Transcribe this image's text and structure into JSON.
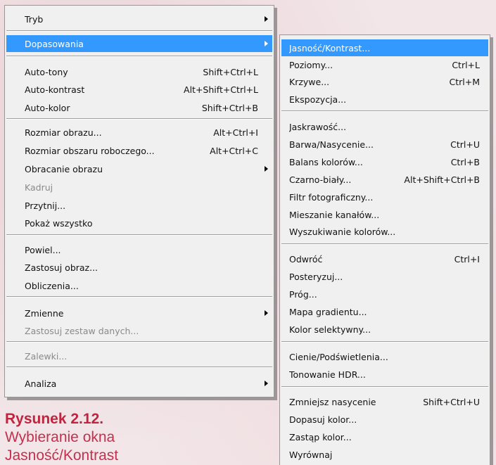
{
  "menu_main": {
    "tryb": {
      "label": "Tryb"
    },
    "dopasowania": {
      "label": "Dopasowania"
    },
    "auto_tony": {
      "label": "Auto-tony",
      "shortcut": "Shift+Ctrl+L"
    },
    "auto_kontrast": {
      "label": "Auto-kontrast",
      "shortcut": "Alt+Shift+Ctrl+L"
    },
    "auto_kolor": {
      "label": "Auto-kolor",
      "shortcut": "Shift+Ctrl+B"
    },
    "rozmiar_obrazu": {
      "label": "Rozmiar obrazu...",
      "shortcut": "Alt+Ctrl+I"
    },
    "rozmiar_obszaru": {
      "label": "Rozmiar obszaru roboczego...",
      "shortcut": "Alt+Ctrl+C"
    },
    "obracanie": {
      "label": "Obracanie obrazu"
    },
    "kadruj": {
      "label": "Kadruj"
    },
    "przytnij": {
      "label": "Przytnij..."
    },
    "pokaz_wszystko": {
      "label": "Pokaż wszystko"
    },
    "powiel": {
      "label": "Powiel..."
    },
    "zastosuj_obraz": {
      "label": "Zastosuj obraz..."
    },
    "obliczenia": {
      "label": "Obliczenia..."
    },
    "zmienne": {
      "label": "Zmienne"
    },
    "zastosuj_zestaw": {
      "label": "Zastosuj zestaw danych..."
    },
    "zalewki": {
      "label": "Zalewki..."
    },
    "analiza": {
      "label": "Analiza"
    }
  },
  "menu_adjust": {
    "jasnosc": {
      "label": "Jasność/Kontrast..."
    },
    "poziomy": {
      "label": "Poziomy...",
      "shortcut": "Ctrl+L"
    },
    "krzywe": {
      "label": "Krzywe...",
      "shortcut": "Ctrl+M"
    },
    "ekspozycja": {
      "label": "Ekspozycja..."
    },
    "jaskrawosc": {
      "label": "Jaskrawość..."
    },
    "barwa": {
      "label": "Barwa/Nasycenie...",
      "shortcut": "Ctrl+U"
    },
    "balans": {
      "label": "Balans kolorów...",
      "shortcut": "Ctrl+B"
    },
    "czarno_bialy": {
      "label": "Czarno-biały...",
      "shortcut": "Alt+Shift+Ctrl+B"
    },
    "filtr": {
      "label": "Filtr fotograficzny..."
    },
    "mieszanie": {
      "label": "Mieszanie kanałów..."
    },
    "wyszukiwanie": {
      "label": "Wyszukiwanie kolorów..."
    },
    "odwroc": {
      "label": "Odwróć",
      "shortcut": "Ctrl+I"
    },
    "posteryzuj": {
      "label": "Posteryzuj..."
    },
    "prog": {
      "label": "Próg..."
    },
    "mapa": {
      "label": "Mapa gradientu..."
    },
    "kolor_selektywny": {
      "label": "Kolor selektywny..."
    },
    "cienie": {
      "label": "Cienie/Podświetlenia..."
    },
    "tonowanie": {
      "label": "Tonowanie HDR..."
    },
    "zmniejsz": {
      "label": "Zmniejsz nasycenie",
      "shortcut": "Shift+Ctrl+U"
    },
    "dopasuj": {
      "label": "Dopasuj kolor..."
    },
    "zastap": {
      "label": "Zastąp kolor..."
    },
    "wyrownaj": {
      "label": "Wyrównaj"
    }
  },
  "caption": {
    "title": "Rysunek 2.12.",
    "line1": "Wybieranie okna",
    "line2": "Jasność/Kontrast"
  }
}
